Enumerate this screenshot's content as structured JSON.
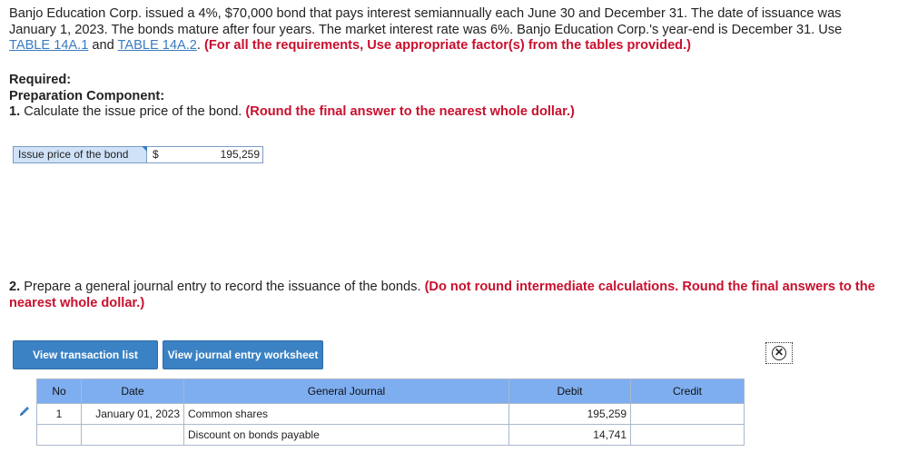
{
  "intro": {
    "text_1": "Banjo Education Corp. issued a 4%, $70,000 bond that pays interest semiannually each June 30 and December 31. The date of issuance was January 1, 2023. The bonds mature after four years. The market interest rate was 6%. Banjo Education Corp.'s year-end is December 31. Use ",
    "link_1": "TABLE 14A.1",
    "text_2": " and ",
    "link_2": "TABLE 14A.2",
    "text_3": ". ",
    "note": "(For all the requirements, Use appropriate factor(s) from the tables provided.)"
  },
  "required": {
    "heading": "Required:",
    "component": "Preparation Component:",
    "q1_number": "1.",
    "q1_text": " Calculate the issue price of the bond. ",
    "q1_note": "(Round the final answer to the nearest whole dollar.)"
  },
  "issue_price": {
    "label": "Issue price of the bond",
    "currency": "$",
    "value": "195,259"
  },
  "q2": {
    "number": "2.",
    "text": " Prepare a general journal entry to record the issuance of the bonds. ",
    "note": "(Do not round intermediate calculations. Round the final answers to the nearest whole dollar.)"
  },
  "buttons": {
    "view_transactions": "View transaction list",
    "view_worksheet": "View journal entry worksheet"
  },
  "journal": {
    "headers": [
      "No",
      "Date",
      "General Journal",
      "Debit",
      "Credit"
    ],
    "rows": [
      {
        "no": "1",
        "date": "January 01, 2023",
        "account": "Common shares",
        "debit": "195,259",
        "credit": ""
      },
      {
        "no": "",
        "date": "",
        "account": "Discount on bonds payable",
        "debit": "14,741",
        "credit": ""
      }
    ]
  },
  "colors": {
    "accent_blue": "#3b82c4",
    "header_blue": "#7eaef0",
    "red_note": "#c8102e",
    "link": "#3a7bbf"
  },
  "icons": [
    "pencil-icon",
    "close-icon"
  ]
}
